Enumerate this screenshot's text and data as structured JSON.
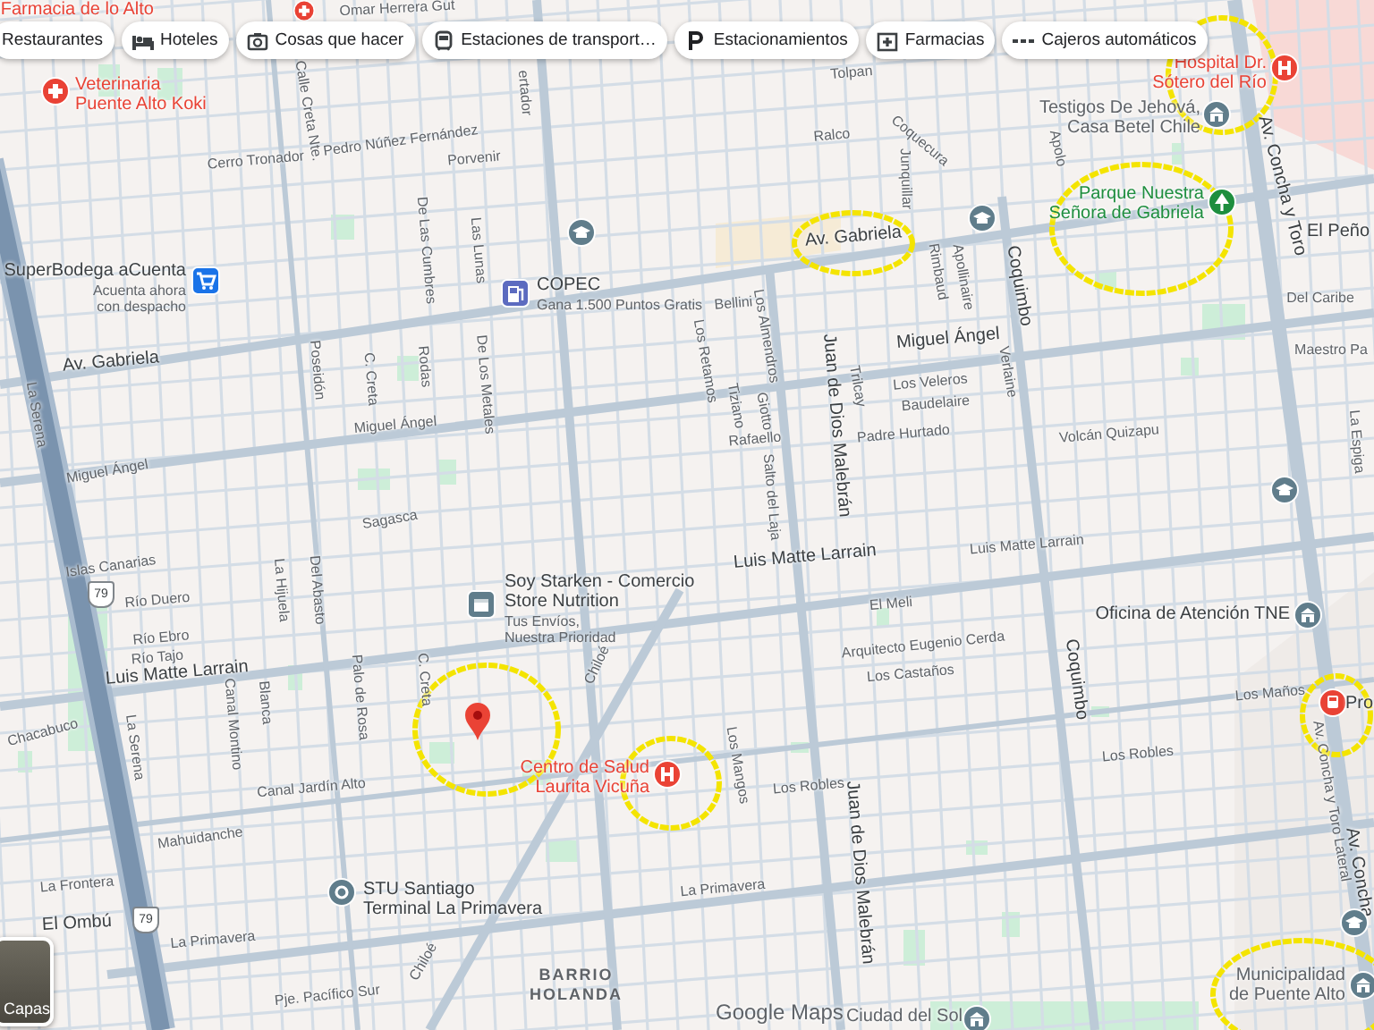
{
  "category_chips": [
    {
      "label": "Restaurantes",
      "kind": "restaurants"
    },
    {
      "label": "Hoteles",
      "kind": "hotels"
    },
    {
      "label": "Cosas que hacer",
      "kind": "activities"
    },
    {
      "label": "Estaciones de transport…",
      "kind": "transit"
    },
    {
      "label": "Estacionamientos",
      "kind": "parking"
    },
    {
      "label": "Farmacias",
      "kind": "pharmacy"
    },
    {
      "label": "Cajeros automáticos",
      "kind": "atm"
    }
  ],
  "places": [
    {
      "name": [
        "Farmacia de lo Alto"
      ],
      "kind": "pharmacy"
    },
    {
      "name": [
        "Veterinaria",
        "Puente Alto Koki"
      ],
      "kind": "vet"
    },
    {
      "name": [
        "SuperBodega aCuenta"
      ],
      "subtitle": [
        "Acuenta ahora",
        "con despacho"
      ],
      "kind": "shop"
    },
    {
      "name": [
        "COPEC"
      ],
      "subtitle": [
        "Gana 1.500 Puntos Gratis"
      ],
      "kind": "gas"
    },
    {
      "name": [
        "Hospital Dr.",
        "Sótero del Río"
      ],
      "kind": "hospital"
    },
    {
      "name": [
        "Testigos De Jehová,",
        "Casa Betel Chile"
      ],
      "kind": "worship"
    },
    {
      "name": [
        "Parque Nuestra",
        "Señora de Gabriela"
      ],
      "kind": "park"
    },
    {
      "name": [
        "Soy Starken - Comercio",
        "Store Nutrition"
      ],
      "subtitle": [
        "Tus Envíos,",
        "Nuestra Prioridad"
      ],
      "kind": "parcel"
    },
    {
      "name": [
        "Oficina de Atención TNE"
      ],
      "kind": "office"
    },
    {
      "name": [
        "Centro de Salud",
        "Laurita Vicuña"
      ],
      "kind": "hospital"
    },
    {
      "name": [
        "STU Santiago",
        "Terminal La Primavera"
      ],
      "kind": "transit"
    },
    {
      "name": [
        "Municipalidad",
        "de Puente Alto"
      ],
      "kind": "civic"
    },
    {
      "name": [
        "Ciudad del Sol"
      ],
      "kind": "civic"
    },
    {
      "name": [
        "Pro"
      ],
      "kind": "rail"
    }
  ],
  "streets": [
    {
      "name": "Omar Herrera Gut",
      "kind": "minor"
    },
    {
      "name": "Calle Creta Nte.",
      "kind": "minor"
    },
    {
      "name": "ertador",
      "kind": "minor"
    },
    {
      "name": "Tolpan",
      "kind": "minor"
    },
    {
      "name": "Pedro Núñez Fernández",
      "kind": "minor"
    },
    {
      "name": "Cerro Tronador",
      "kind": "minor"
    },
    {
      "name": "Porvenir",
      "kind": "minor"
    },
    {
      "name": "Ralco",
      "kind": "minor"
    },
    {
      "name": "Coquecura",
      "kind": "minor"
    },
    {
      "name": "Junquillar",
      "kind": "minor"
    },
    {
      "name": "Apolo",
      "kind": "minor"
    },
    {
      "name": "De Las Cumbres",
      "kind": "minor"
    },
    {
      "name": "Las Lunas",
      "kind": "minor"
    },
    {
      "name": "Av. Gabriela",
      "kind": "major"
    },
    {
      "name": "Av. Concha y Toro",
      "kind": "major"
    },
    {
      "name": "El Peño",
      "kind": "major"
    },
    {
      "name": "Del Caribe",
      "kind": "minor"
    },
    {
      "name": "Maestro Pa",
      "kind": "minor"
    },
    {
      "name": "Av. Gabriela",
      "kind": "major"
    },
    {
      "name": "La Serena",
      "kind": "minor"
    },
    {
      "name": "Los Retamos",
      "kind": "minor"
    },
    {
      "name": "Bellini",
      "kind": "minor"
    },
    {
      "name": "Los Almendros",
      "kind": "minor"
    },
    {
      "name": "Rimbaud",
      "kind": "minor"
    },
    {
      "name": "Apollinaire",
      "kind": "minor"
    },
    {
      "name": "Coquimbo",
      "kind": "major"
    },
    {
      "name": "Miguel Ángel",
      "kind": "major"
    },
    {
      "name": "Los Veleros",
      "kind": "minor"
    },
    {
      "name": "Baudelaire",
      "kind": "minor"
    },
    {
      "name": "Verlaine",
      "kind": "minor"
    },
    {
      "name": "Trilcay",
      "kind": "minor"
    },
    {
      "name": "Tiziano",
      "kind": "minor"
    },
    {
      "name": "Giotto",
      "kind": "minor"
    },
    {
      "name": "Rafaello",
      "kind": "minor"
    },
    {
      "name": "Padre Hurtado",
      "kind": "minor"
    },
    {
      "name": "Volcán Quizapu",
      "kind": "minor"
    },
    {
      "name": "La Espiga",
      "kind": "minor"
    },
    {
      "name": "Juan de Dios Malebrán",
      "kind": "major"
    },
    {
      "name": "Poseidón",
      "kind": "minor"
    },
    {
      "name": "C. Creta",
      "kind": "minor"
    },
    {
      "name": "Rodas",
      "kind": "minor"
    },
    {
      "name": "De Los Metales",
      "kind": "minor"
    },
    {
      "name": "Miguel Ángel",
      "kind": "minor"
    },
    {
      "name": "Miguel Ángel",
      "kind": "minor"
    },
    {
      "name": "Sagasca",
      "kind": "minor"
    },
    {
      "name": "Salto del Laja",
      "kind": "minor"
    },
    {
      "name": "Islas Canarias",
      "kind": "minor"
    },
    {
      "name": "Río Duero",
      "kind": "minor"
    },
    {
      "name": "Río Ebro",
      "kind": "minor"
    },
    {
      "name": "Río Tajo",
      "kind": "minor"
    },
    {
      "name": "La Hijuela",
      "kind": "minor"
    },
    {
      "name": "Del Abasto",
      "kind": "minor"
    },
    {
      "name": "Luis Matte Larrain",
      "kind": "major"
    },
    {
      "name": "Luis Matte Larrain",
      "kind": "minor"
    },
    {
      "name": "Luis Matte Larrain",
      "kind": "major"
    },
    {
      "name": "El Meli",
      "kind": "minor"
    },
    {
      "name": "Arquitecto Eugenio Cerda",
      "kind": "minor"
    },
    {
      "name": "Los Castaños",
      "kind": "minor"
    },
    {
      "name": "Los Maños",
      "kind": "minor"
    },
    {
      "name": "Coquimbo",
      "kind": "major"
    },
    {
      "name": "Chiloé",
      "kind": "minor"
    },
    {
      "name": "C. Creta",
      "kind": "minor"
    },
    {
      "name": "Blanca",
      "kind": "minor"
    },
    {
      "name": "Canal Montino",
      "kind": "minor"
    },
    {
      "name": "Palo de Rosa",
      "kind": "minor"
    },
    {
      "name": "La Serena",
      "kind": "minor"
    },
    {
      "name": "Chacabuco",
      "kind": "minor"
    },
    {
      "name": "Canal Jardín Alto",
      "kind": "minor"
    },
    {
      "name": "Mahuidanche",
      "kind": "minor"
    },
    {
      "name": "La Frontera",
      "kind": "minor"
    },
    {
      "name": "El Ombú",
      "kind": "major"
    },
    {
      "name": "La Primavera",
      "kind": "minor"
    },
    {
      "name": "Pje. Pacífico Sur",
      "kind": "minor"
    },
    {
      "name": "Chiloé",
      "kind": "minor"
    },
    {
      "name": "La Primavera",
      "kind": "minor"
    },
    {
      "name": "Los Mangos",
      "kind": "minor"
    },
    {
      "name": "Los Robles",
      "kind": "minor"
    },
    {
      "name": "Los Robles",
      "kind": "minor"
    },
    {
      "name": "Juan de Dios Malebrán",
      "kind": "major"
    },
    {
      "name": "Av. Concha y Toro Lateral",
      "kind": "minor"
    },
    {
      "name": "Av. Concha",
      "kind": "major"
    }
  ],
  "area_label": [
    "BARRIO",
    "HOLANDA"
  ],
  "route_shields": [
    "79",
    "79"
  ],
  "layers_button": {
    "label": "Capas"
  },
  "map_logo": "Google Maps"
}
